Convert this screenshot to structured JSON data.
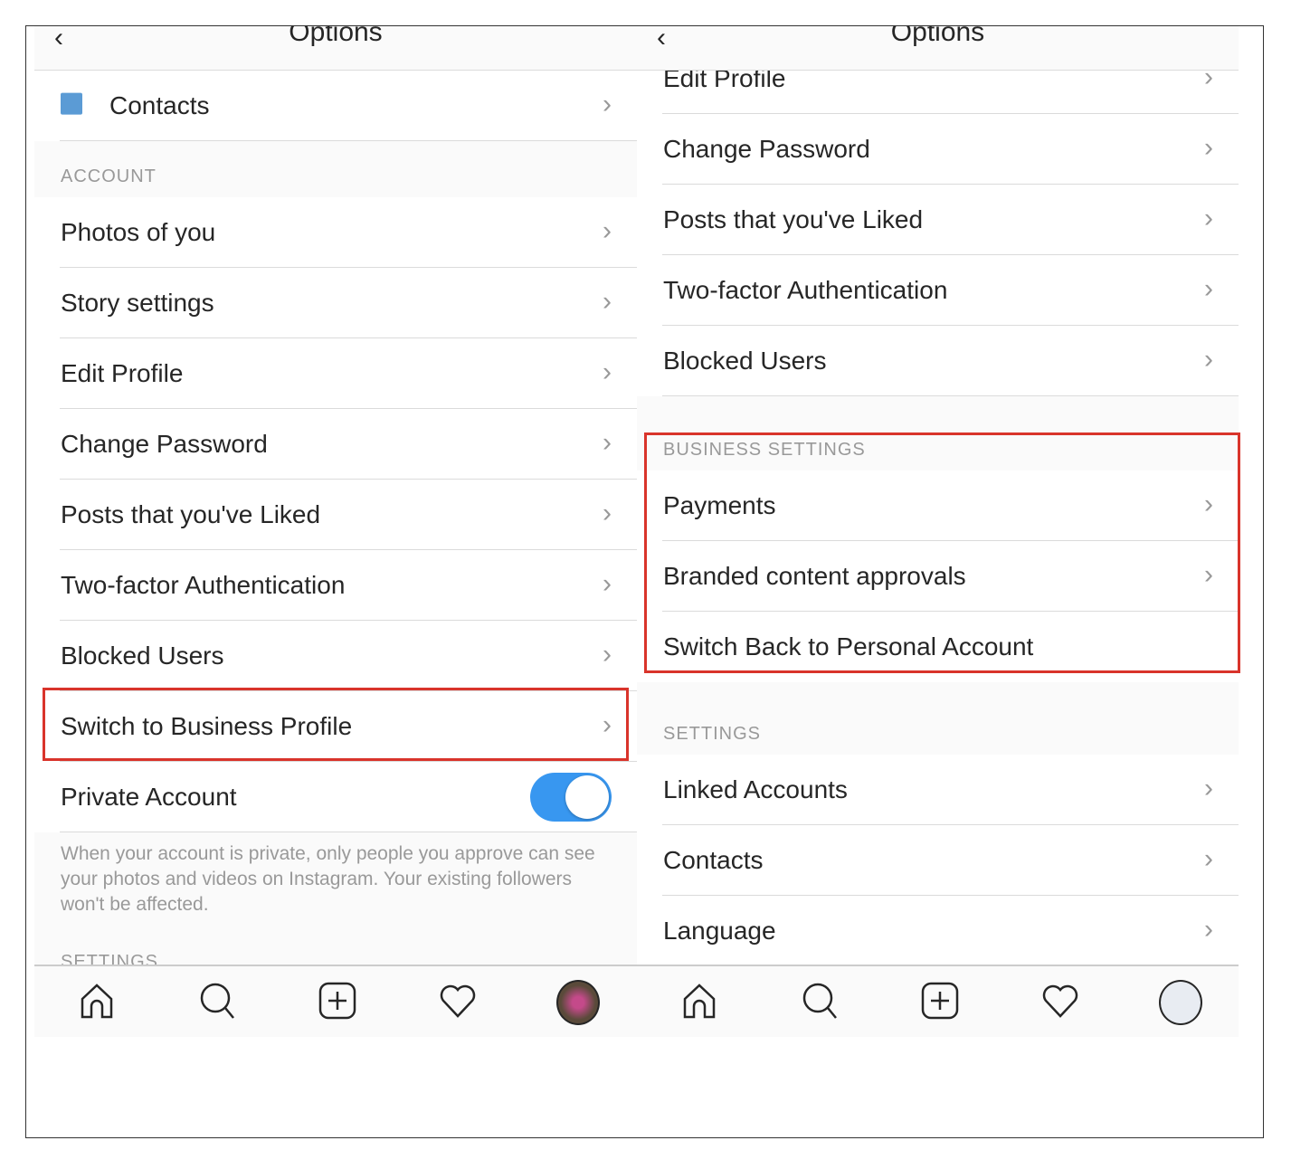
{
  "left": {
    "title": "Options",
    "top_row": {
      "label": "Contacts",
      "icon": "contacts-icon"
    },
    "account_header": "ACCOUNT",
    "items": [
      "Photos of you",
      "Story settings",
      "Edit Profile",
      "Change Password",
      "Posts that you've Liked",
      "Two-factor Authentication",
      "Blocked Users",
      "Switch to Business Profile"
    ],
    "private_account": {
      "label": "Private Account",
      "enabled": true
    },
    "private_description": "When your account is private, only people you approve can see your photos and videos on Instagram. Your existing followers won't be affected.",
    "cut_header": "SETTINGS"
  },
  "right": {
    "title": "Options",
    "items": [
      "Edit Profile",
      "Change Password",
      "Posts that you've Liked",
      "Two-factor Authentication",
      "Blocked Users"
    ],
    "business_header": "BUSINESS SETTINGS",
    "business_items": [
      "Payments",
      "Branded content approvals",
      "Switch Back to Personal Account"
    ],
    "settings_header": "SETTINGS",
    "settings_items": [
      "Linked Accounts",
      "Contacts",
      "Language"
    ]
  },
  "tabs": [
    "home-icon",
    "search-icon",
    "new-post-icon",
    "activity-heart-icon",
    "profile-avatar"
  ],
  "colors": {
    "highlight": "#d9342b",
    "toggle": "#3897f0"
  }
}
